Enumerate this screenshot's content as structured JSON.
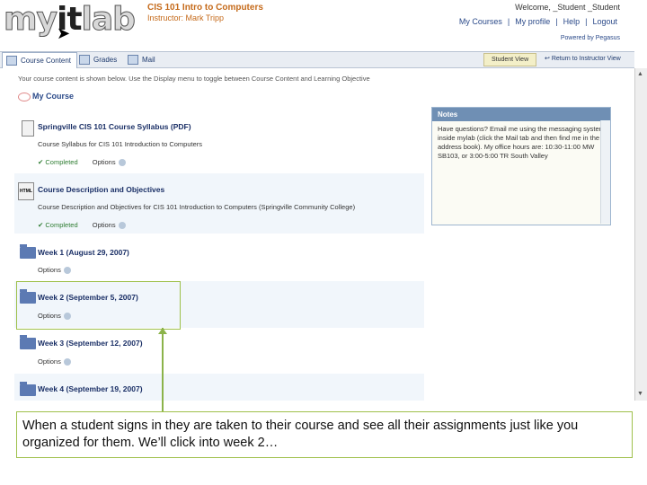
{
  "header": {
    "logo": {
      "my": "my",
      "it": "it",
      "lab": "lab"
    },
    "course_title": "CIS 101 Intro to Computers",
    "instructor": "Instructor: Mark Tripp",
    "welcome": "Welcome, _Student _Student",
    "links": [
      "My Courses",
      "|",
      "My profile",
      "|",
      "Help",
      "|",
      "Logout"
    ],
    "powered_by": "Powered by Pegasus"
  },
  "tabs": [
    {
      "label": "Course Content",
      "icon": "content-icon",
      "active": true
    },
    {
      "label": "Grades",
      "icon": "grades-icon"
    },
    {
      "label": "Mail",
      "icon": "mail-icon"
    }
  ],
  "toolbar_right": {
    "student_view": "Student View",
    "return_instructor": "Return to Instructor View"
  },
  "intro": "Your course content is shown below. Use the Display menu to toggle between Course Content and Learning Objective",
  "my_course": "My Course",
  "items": [
    {
      "title": "Springville CIS 101 Course Syllabus (PDF)",
      "desc": "Course Syllabus for CIS 101 Introduction to Computers",
      "status": "✔ Completed",
      "options": "Options"
    },
    {
      "title": "Course Description and Objectives",
      "desc": "Course Description and Objectives for CIS 101 Introduction to Computers (Springville Community College)",
      "status": "✔ Completed",
      "options": "Options"
    }
  ],
  "weeks": [
    {
      "title": "Week 1 (August 29, 2007)",
      "options": "Options"
    },
    {
      "title": "Week 2 (September 5, 2007)",
      "options": "Options"
    },
    {
      "title": "Week 3 (September 12, 2007)",
      "options": "Options"
    },
    {
      "title": "Week 4 (September 19, 2007)",
      "options": "Options"
    }
  ],
  "notes": {
    "title": "Notes",
    "body": "Have questions? Email me using the messaging system inside mylab (click the Mail tab and then find me in the address book). My office hours are: 10:30-11:00 MW SB103, or 3:00-5:00 TR South Valley"
  },
  "html_badge": "HTML",
  "callout": "When a student signs in they are taken to their course and see all their assignments just like you organized for them. We’ll click into week 2…"
}
